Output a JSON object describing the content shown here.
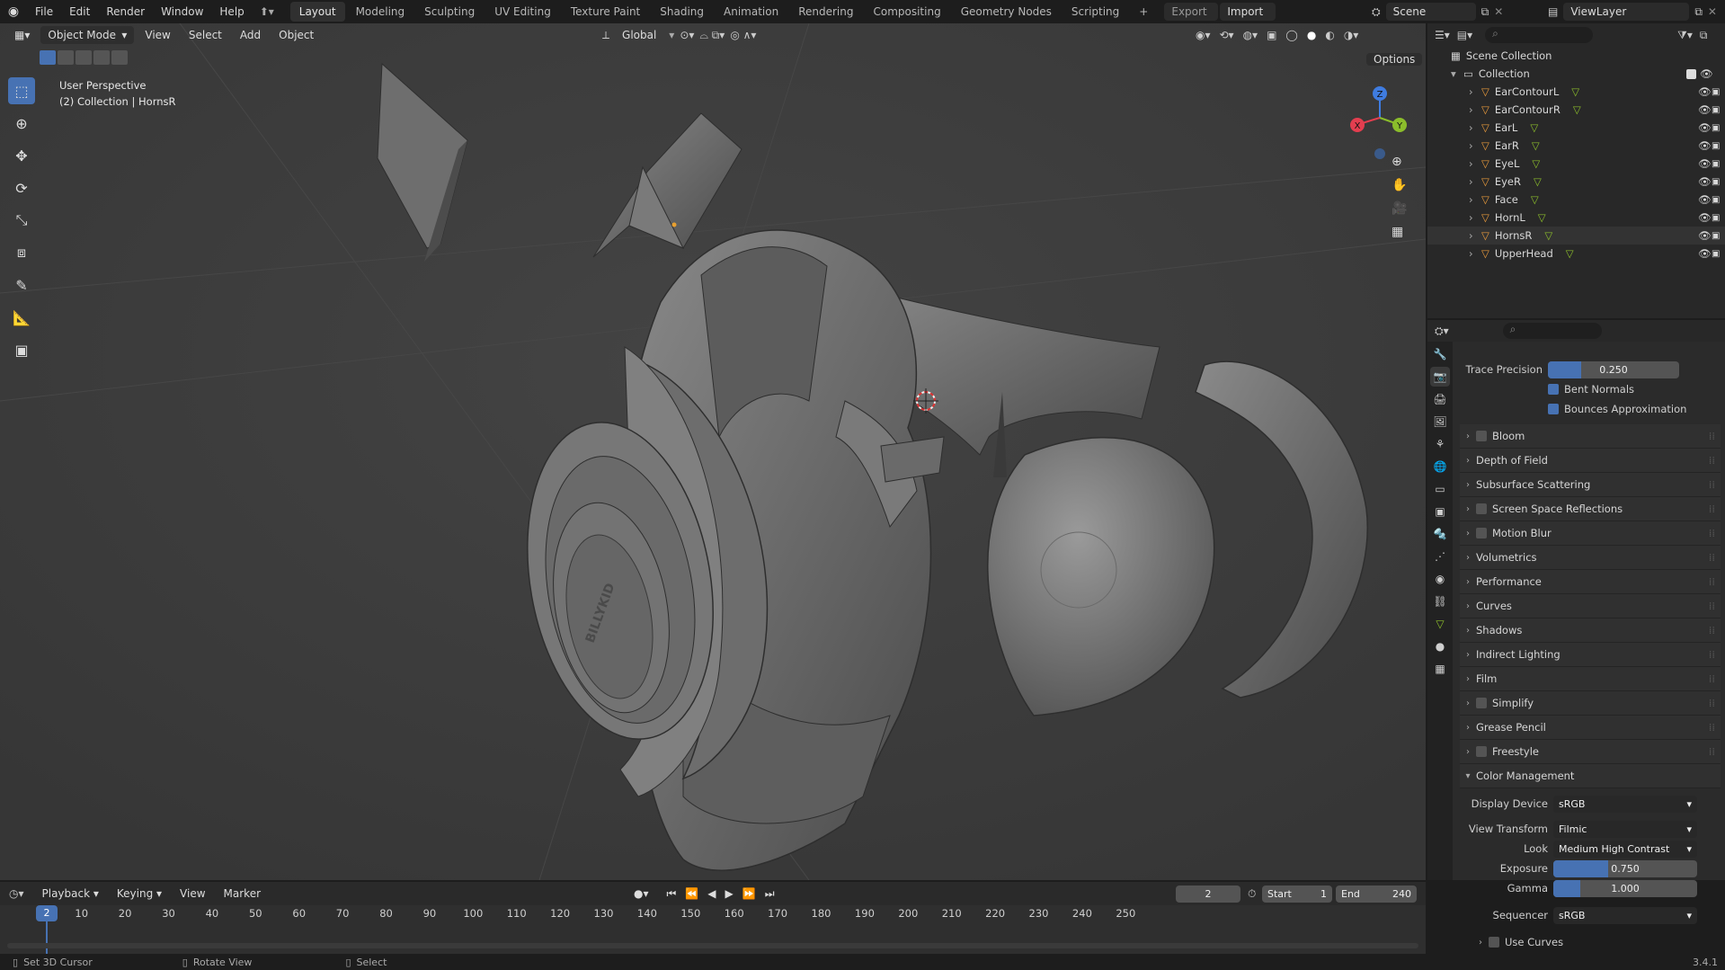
{
  "topbar": {
    "menus": [
      "File",
      "Edit",
      "Render",
      "Window",
      "Help"
    ],
    "workspaces": [
      "Layout",
      "Modeling",
      "Sculpting",
      "UV Editing",
      "Texture Paint",
      "Shading",
      "Animation",
      "Rendering",
      "Compositing",
      "Geometry Nodes",
      "Scripting"
    ],
    "active_workspace": "Layout",
    "export_label": "Export",
    "import_label": "Import",
    "scene": "Scene",
    "view_layer": "ViewLayer"
  },
  "viewport": {
    "mode": "Object Mode",
    "menus": [
      "View",
      "Select",
      "Add",
      "Object"
    ],
    "transform_orientation": "Global",
    "options_label": "Options",
    "overlay_title": "User Perspective",
    "overlay_subtitle": "(2) Collection | HornsR",
    "gizmo_axes": [
      "X",
      "Y",
      "Z"
    ],
    "model_text": "BILLYKID"
  },
  "outliner": {
    "root": "Scene Collection",
    "collection": "Collection",
    "items": [
      "EarContourL",
      "EarContourR",
      "EarL",
      "EarR",
      "EyeL",
      "EyeR",
      "Face",
      "HornL",
      "HornsR",
      "UpperHead"
    ]
  },
  "properties": {
    "trace_precision_label": "Trace Precision",
    "trace_precision": "0.250",
    "trace_precision_fraction": 0.25,
    "bent_normals": "Bent Normals",
    "bounces_approx": "Bounces Approximation",
    "sections": [
      {
        "label": "Bloom",
        "checkbox": true
      },
      {
        "label": "Depth of Field",
        "checkbox": false
      },
      {
        "label": "Subsurface Scattering",
        "checkbox": false
      },
      {
        "label": "Screen Space Reflections",
        "checkbox": true
      },
      {
        "label": "Motion Blur",
        "checkbox": true
      },
      {
        "label": "Volumetrics",
        "checkbox": false
      },
      {
        "label": "Performance",
        "checkbox": false
      },
      {
        "label": "Curves",
        "checkbox": false
      },
      {
        "label": "Shadows",
        "checkbox": false
      },
      {
        "label": "Indirect Lighting",
        "checkbox": false
      },
      {
        "label": "Film",
        "checkbox": false
      },
      {
        "label": "Simplify",
        "checkbox": true
      },
      {
        "label": "Grease Pencil",
        "checkbox": false
      },
      {
        "label": "Freestyle",
        "checkbox": true
      }
    ],
    "color_management": "Color Management",
    "display_device_label": "Display Device",
    "display_device": "sRGB",
    "view_transform_label": "View Transform",
    "view_transform": "Filmic",
    "look_label": "Look",
    "look": "Medium High Contrast",
    "exposure_label": "Exposure",
    "exposure": "0.750",
    "exposure_fraction": 0.38,
    "gamma_label": "Gamma",
    "gamma": "1.000",
    "gamma_fraction": 0.19,
    "sequencer_label": "Sequencer",
    "sequencer": "sRGB",
    "use_curves": "Use Curves"
  },
  "timeline": {
    "menus": [
      "Playback",
      "Keying",
      "View",
      "Marker"
    ],
    "current_frame": "2",
    "start_label": "Start",
    "start": "1",
    "end_label": "End",
    "end": "240",
    "ticks": [
      "10",
      "20",
      "30",
      "40",
      "50",
      "60",
      "70",
      "80",
      "90",
      "100",
      "110",
      "120",
      "130",
      "140",
      "150",
      "160",
      "170",
      "180",
      "190",
      "200",
      "210",
      "220",
      "230",
      "240",
      "250"
    ]
  },
  "statusbar": {
    "hint1": "Set 3D Cursor",
    "hint2": "Rotate View",
    "hint3": "Select",
    "version": "3.4.1"
  },
  "colors": {
    "accent": "#4772b3",
    "x_axis": "#e33e4f",
    "y_axis": "#8bbd2b",
    "z_axis": "#3f7ce0"
  }
}
